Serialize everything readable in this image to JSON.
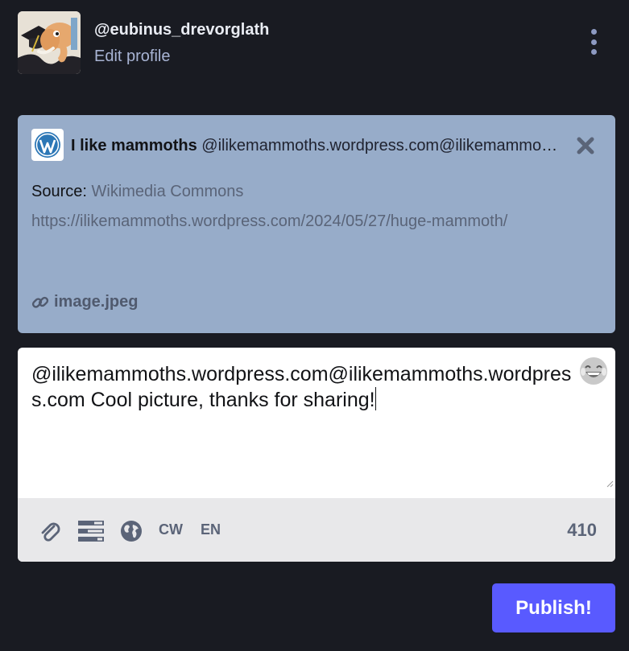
{
  "account": {
    "username": "@eubinus_drevorglath",
    "edit_profile_label": "Edit profile",
    "avatar_icon": "mammoth-graduate-avatar"
  },
  "menu": {
    "icon": "vertical-ellipsis-icon"
  },
  "reply": {
    "display_name": "I like mammoths",
    "account": "@ilikemammoths.wordpress.com@ilikemammoths.wordpress.com",
    "source_label": "Source:",
    "source_link": "Wikimedia Commons",
    "url": "https://ilikemammoths.wordpress.com/2024/05/27/huge-mammoth/",
    "attachment": "image.jpeg",
    "icon": "wordpress-icon",
    "close_icon": "close-icon"
  },
  "composer": {
    "text": "@ilikemammoths.wordpress.com@ilikemammoths.wordpress.com Cool picture, thanks for sharing!",
    "emoji": "😂",
    "cw_label": "CW",
    "lang_label": "EN",
    "char_count": "410",
    "icons": [
      "paperclip-icon",
      "poll-icon",
      "globe-icon"
    ]
  },
  "publish_label": "Publish!",
  "colors": {
    "background": "#191b22",
    "reply_card": "#97acc9",
    "accent": "#595aff",
    "toolbar": "#e8e8ea"
  }
}
